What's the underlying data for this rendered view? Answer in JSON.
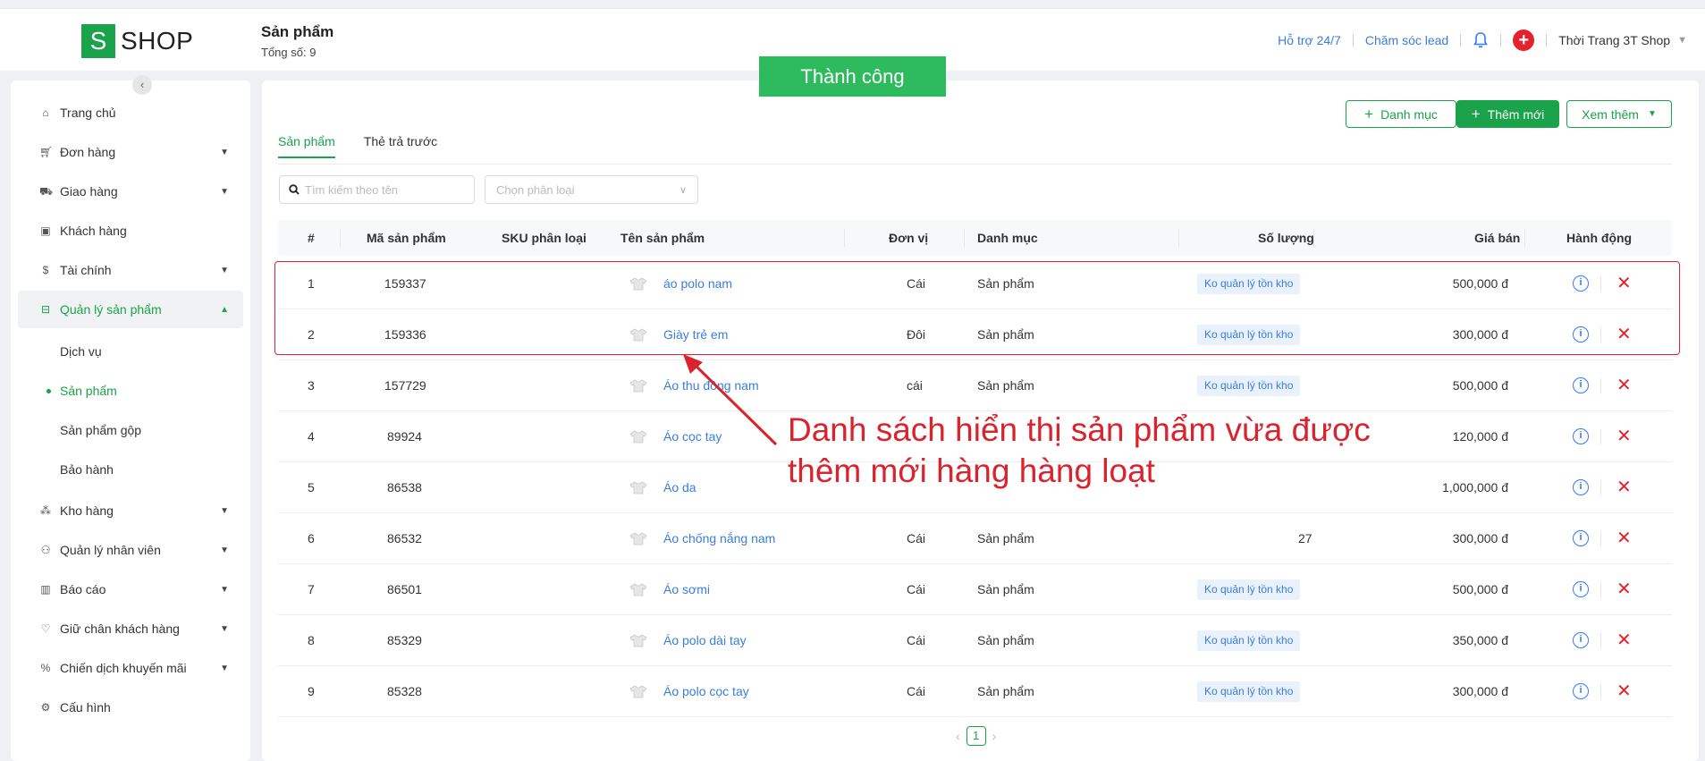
{
  "brand": {
    "badge": "S",
    "name": "SHOP"
  },
  "header": {
    "title": "Sản phẩm",
    "subtitle": "Tổng số: 9",
    "support_link": "Hỗ trợ 24/7",
    "lead_link": "Chăm sóc lead",
    "shop_name": "Thời Trang 3T Shop"
  },
  "toast": {
    "message": "Thành công"
  },
  "sidebar": {
    "items": [
      {
        "label": "Trang chủ",
        "icon": "home-icon"
      },
      {
        "label": "Đơn hàng",
        "icon": "cart-icon"
      },
      {
        "label": "Giao hàng",
        "icon": "truck-icon"
      },
      {
        "label": "Khách hàng",
        "icon": "customer-icon"
      },
      {
        "label": "Tài chính",
        "icon": "dollar-icon"
      },
      {
        "label": "Quản lý sản phẩm",
        "icon": "box-icon"
      },
      {
        "label": "Kho hàng",
        "icon": "warehouse-icon"
      },
      {
        "label": "Quản lý nhân viên",
        "icon": "staff-icon"
      },
      {
        "label": "Báo cáo",
        "icon": "chart-icon"
      },
      {
        "label": "Giữ chân khách hàng",
        "icon": "heart-icon"
      },
      {
        "label": "Chiến dịch khuyến mãi",
        "icon": "promo-icon"
      },
      {
        "label": "Cấu hình",
        "icon": "settings-icon"
      }
    ],
    "subitems": [
      "Dịch vụ",
      "Sản phẩm",
      "Sản phẩm gộp",
      "Bảo hành"
    ]
  },
  "toolbar": {
    "category_button": "Danh mục",
    "add_button": "Thêm mới",
    "more_button": "Xem thêm"
  },
  "tabs": [
    "Sản phẩm",
    "Thẻ trả trước"
  ],
  "filters": {
    "search_placeholder": "Tìm kiếm theo tên",
    "category_placeholder": "Chọn phân loại"
  },
  "table": {
    "columns": [
      "#",
      "Mã sản phẩm",
      "SKU phân loại",
      "Tên sản phẩm",
      "Đơn vị",
      "Danh mục",
      "Số lượng",
      "Giá bán",
      "Hành động"
    ],
    "rows": [
      {
        "no": "1",
        "code": "159337",
        "sku": "",
        "name": "áo polo nam",
        "unit": "Cái",
        "category": "Sản phẩm",
        "qty": "",
        "stock_badge": "Ko quản lý tồn kho",
        "price": "500,000 đ"
      },
      {
        "no": "2",
        "code": "159336",
        "sku": "",
        "name": "Giày trẻ em",
        "unit": "Đôi",
        "category": "Sản phẩm",
        "qty": "",
        "stock_badge": "Ko quản lý tồn kho",
        "price": "300,000 đ"
      },
      {
        "no": "3",
        "code": "157729",
        "sku": "",
        "name": "Áo thu đông nam",
        "unit": "cái",
        "category": "Sản phẩm",
        "qty": "",
        "stock_badge": "Ko quản lý tồn kho",
        "price": "500,000 đ"
      },
      {
        "no": "4",
        "code": "89924",
        "sku": "",
        "name": "Áo cọc tay",
        "unit": "",
        "category": "",
        "qty": "",
        "stock_badge": "",
        "price": "120,000 đ"
      },
      {
        "no": "5",
        "code": "86538",
        "sku": "",
        "name": "Áo da",
        "unit": "",
        "category": "",
        "qty": "",
        "stock_badge": "",
        "price": "1,000,000 đ"
      },
      {
        "no": "6",
        "code": "86532",
        "sku": "",
        "name": "Áo chống nắng nam",
        "unit": "Cái",
        "category": "Sản phẩm",
        "qty": "27",
        "stock_badge": "",
        "price": "300,000 đ"
      },
      {
        "no": "7",
        "code": "86501",
        "sku": "",
        "name": "Áo sơmi",
        "unit": "Cái",
        "category": "Sản phẩm",
        "qty": "",
        "stock_badge": "Ko quản lý tồn kho",
        "price": "500,000 đ"
      },
      {
        "no": "8",
        "code": "85329",
        "sku": "",
        "name": "Áo polo dài tay",
        "unit": "Cái",
        "category": "Sản phẩm",
        "qty": "",
        "stock_badge": "Ko quản lý tồn kho",
        "price": "350,000 đ"
      },
      {
        "no": "9",
        "code": "85328",
        "sku": "",
        "name": "Áo polo cọc tay",
        "unit": "Cái",
        "category": "Sản phẩm",
        "qty": "",
        "stock_badge": "Ko quản lý tồn kho",
        "price": "300,000 đ"
      }
    ]
  },
  "annotation": {
    "line1": "Danh sách hiển thị sản phẩm vừa được",
    "line2": "thêm mới hàng hàng loạt"
  },
  "pagination": {
    "current": "1"
  },
  "colors": {
    "brand_green": "#1aa34a",
    "link_blue": "#3b7ddd",
    "danger_red": "#e5222b",
    "toast_green": "#2dbb5d"
  }
}
